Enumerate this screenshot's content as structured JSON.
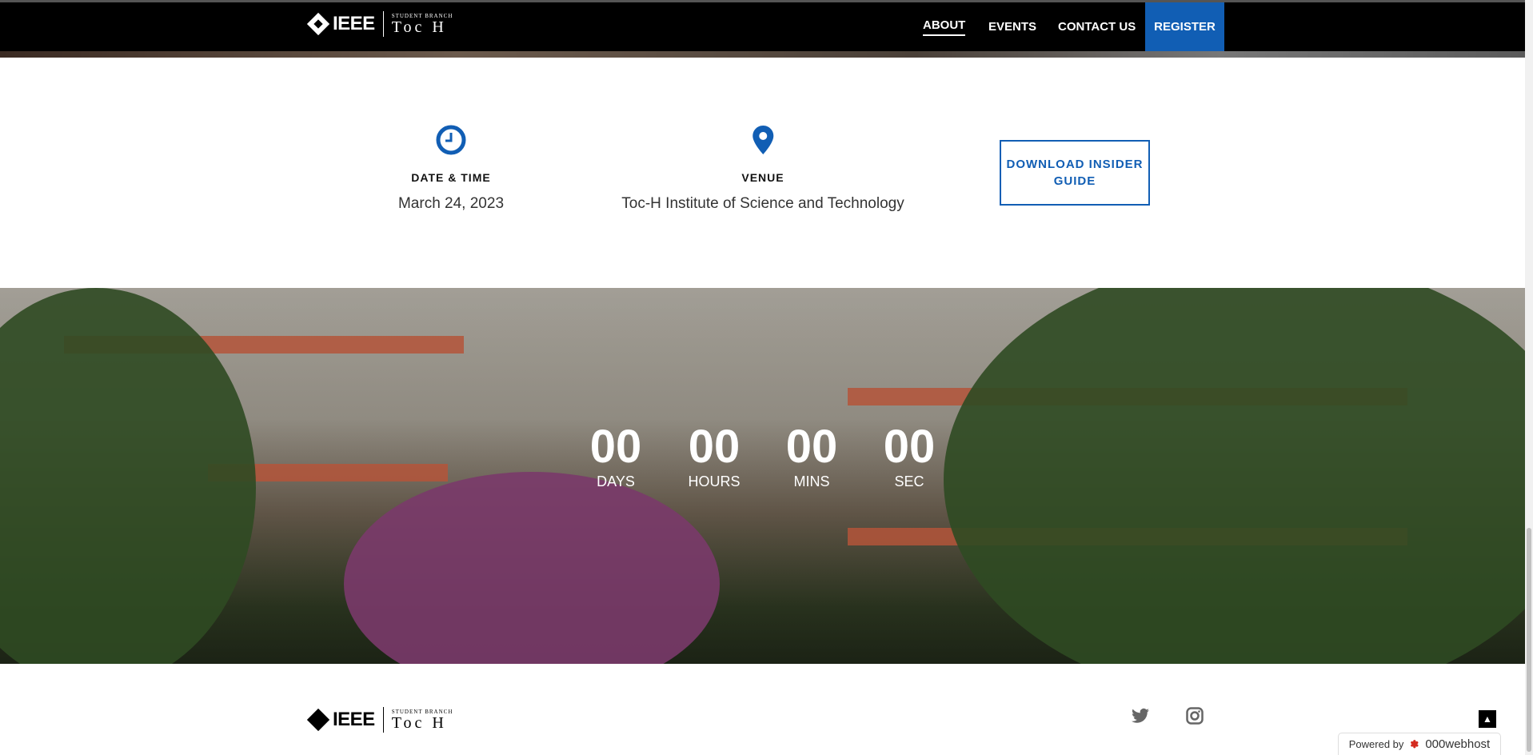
{
  "header": {
    "logo": {
      "ieee": "IEEE",
      "branch": "STUDENT BRANCH",
      "name": "Toc H"
    },
    "nav": [
      {
        "label": "ABOUT",
        "active": true
      },
      {
        "label": "EVENTS"
      },
      {
        "label": "CONTACT US"
      }
    ],
    "register": "REGISTER"
  },
  "info": {
    "date": {
      "label": "DATE & TIME",
      "value": "March 24, 2023",
      "icon": "clock-icon"
    },
    "venue": {
      "label": "VENUE",
      "value": "Toc-H Institute of Science and Technology",
      "icon": "map-pin-icon"
    },
    "download": "DOWNLOAD INSIDER GUIDE"
  },
  "countdown": [
    {
      "value": "00",
      "unit": "DAYS"
    },
    {
      "value": "00",
      "unit": "HOURS"
    },
    {
      "value": "00",
      "unit": "MINS"
    },
    {
      "value": "00",
      "unit": "SEC"
    }
  ],
  "footer": {
    "logo": {
      "ieee": "IEEE",
      "branch": "STUDENT BRANCH",
      "name": "Toc H"
    },
    "social": [
      "twitter-icon",
      "instagram-icon"
    ]
  },
  "powered": {
    "prefix": "Powered by",
    "brand": "000webhost"
  },
  "colors": {
    "accent": "#115eb4"
  }
}
